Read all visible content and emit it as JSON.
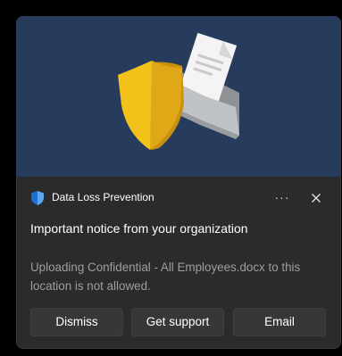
{
  "notification": {
    "app_name": "Data Loss Prevention",
    "app_icon": "shield-icon",
    "hero_image": "shield-and-document-illustration",
    "more_label": "···",
    "title": "Important notice from your organization",
    "body": "Uploading Confidential - All Employees.docx to this location is not allowed.",
    "actions": {
      "dismiss": "Dismiss",
      "support": "Get support",
      "email": "Email"
    }
  },
  "colors": {
    "toast_background": "#2b2b2b",
    "hero_background": "#273b5c",
    "shield_yellow": "#f2c21b",
    "shield_icon_blue": "#1c6fd6",
    "button_background": "#373737"
  }
}
